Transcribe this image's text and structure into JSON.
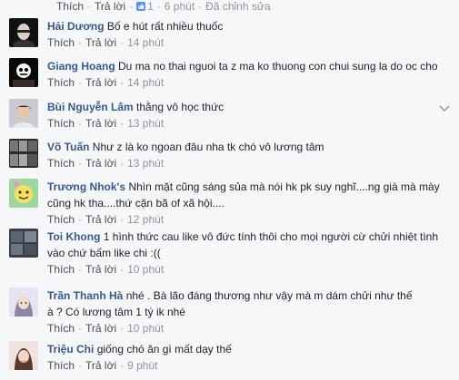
{
  "top": {
    "like": "Thích",
    "reply": "Trả lời",
    "count": "1",
    "time": "6 phút",
    "edited": "Đã chỉnh sửa"
  },
  "action_labels": {
    "like": "Thích",
    "reply": "Trả lời"
  },
  "comments": [
    {
      "name": "Hải Dương",
      "lines": [
        "Bố e hút rất nhiều thuốc"
      ],
      "time": "14 phút"
    },
    {
      "name": "Giang Hoang",
      "lines": [
        "Du ma no thai nguoi ta z ma ko thuong con chui sung la do oc cho"
      ],
      "time": "14 phút"
    },
    {
      "name": "Bùi Nguyễn Lâm",
      "lines": [
        "thằng vô học thức"
      ],
      "time": "13 phút"
    },
    {
      "name": "Võ Tuấn",
      "lines": [
        "Như z là ko ngoan đâu nha tk chó vô lương tâm"
      ],
      "time": "13 phút"
    },
    {
      "name": "Trương Nhok's",
      "lines": [
        "Nhìn mặt cũng sáng sủa mà nói hk pk suy nghĩ....ng già mà mày",
        "cũng hk tha....thứ cặn bã of xã hội...."
      ],
      "time": "12 phút"
    },
    {
      "name": "Toi Khong",
      "lines": [
        "1 hình thức cau like vô đức tính thôi cho mọi người cừ chửi nhiệt tình",
        "vào chứ bấm like chi :(("
      ],
      "time": "10 phút"
    },
    {
      "name": "Trần Thanh Hà",
      "lines": [
        "nhé . Bà lão đáng thương như vậy mà m dám chửi như thế",
        "à ? Có lương tâm 1 tý ik nhé"
      ],
      "time": "10 phút"
    },
    {
      "name": "Triệu Chi",
      "lines": [
        "giống chó ăn gì mất dạy thế"
      ],
      "time": "9 phút"
    }
  ]
}
